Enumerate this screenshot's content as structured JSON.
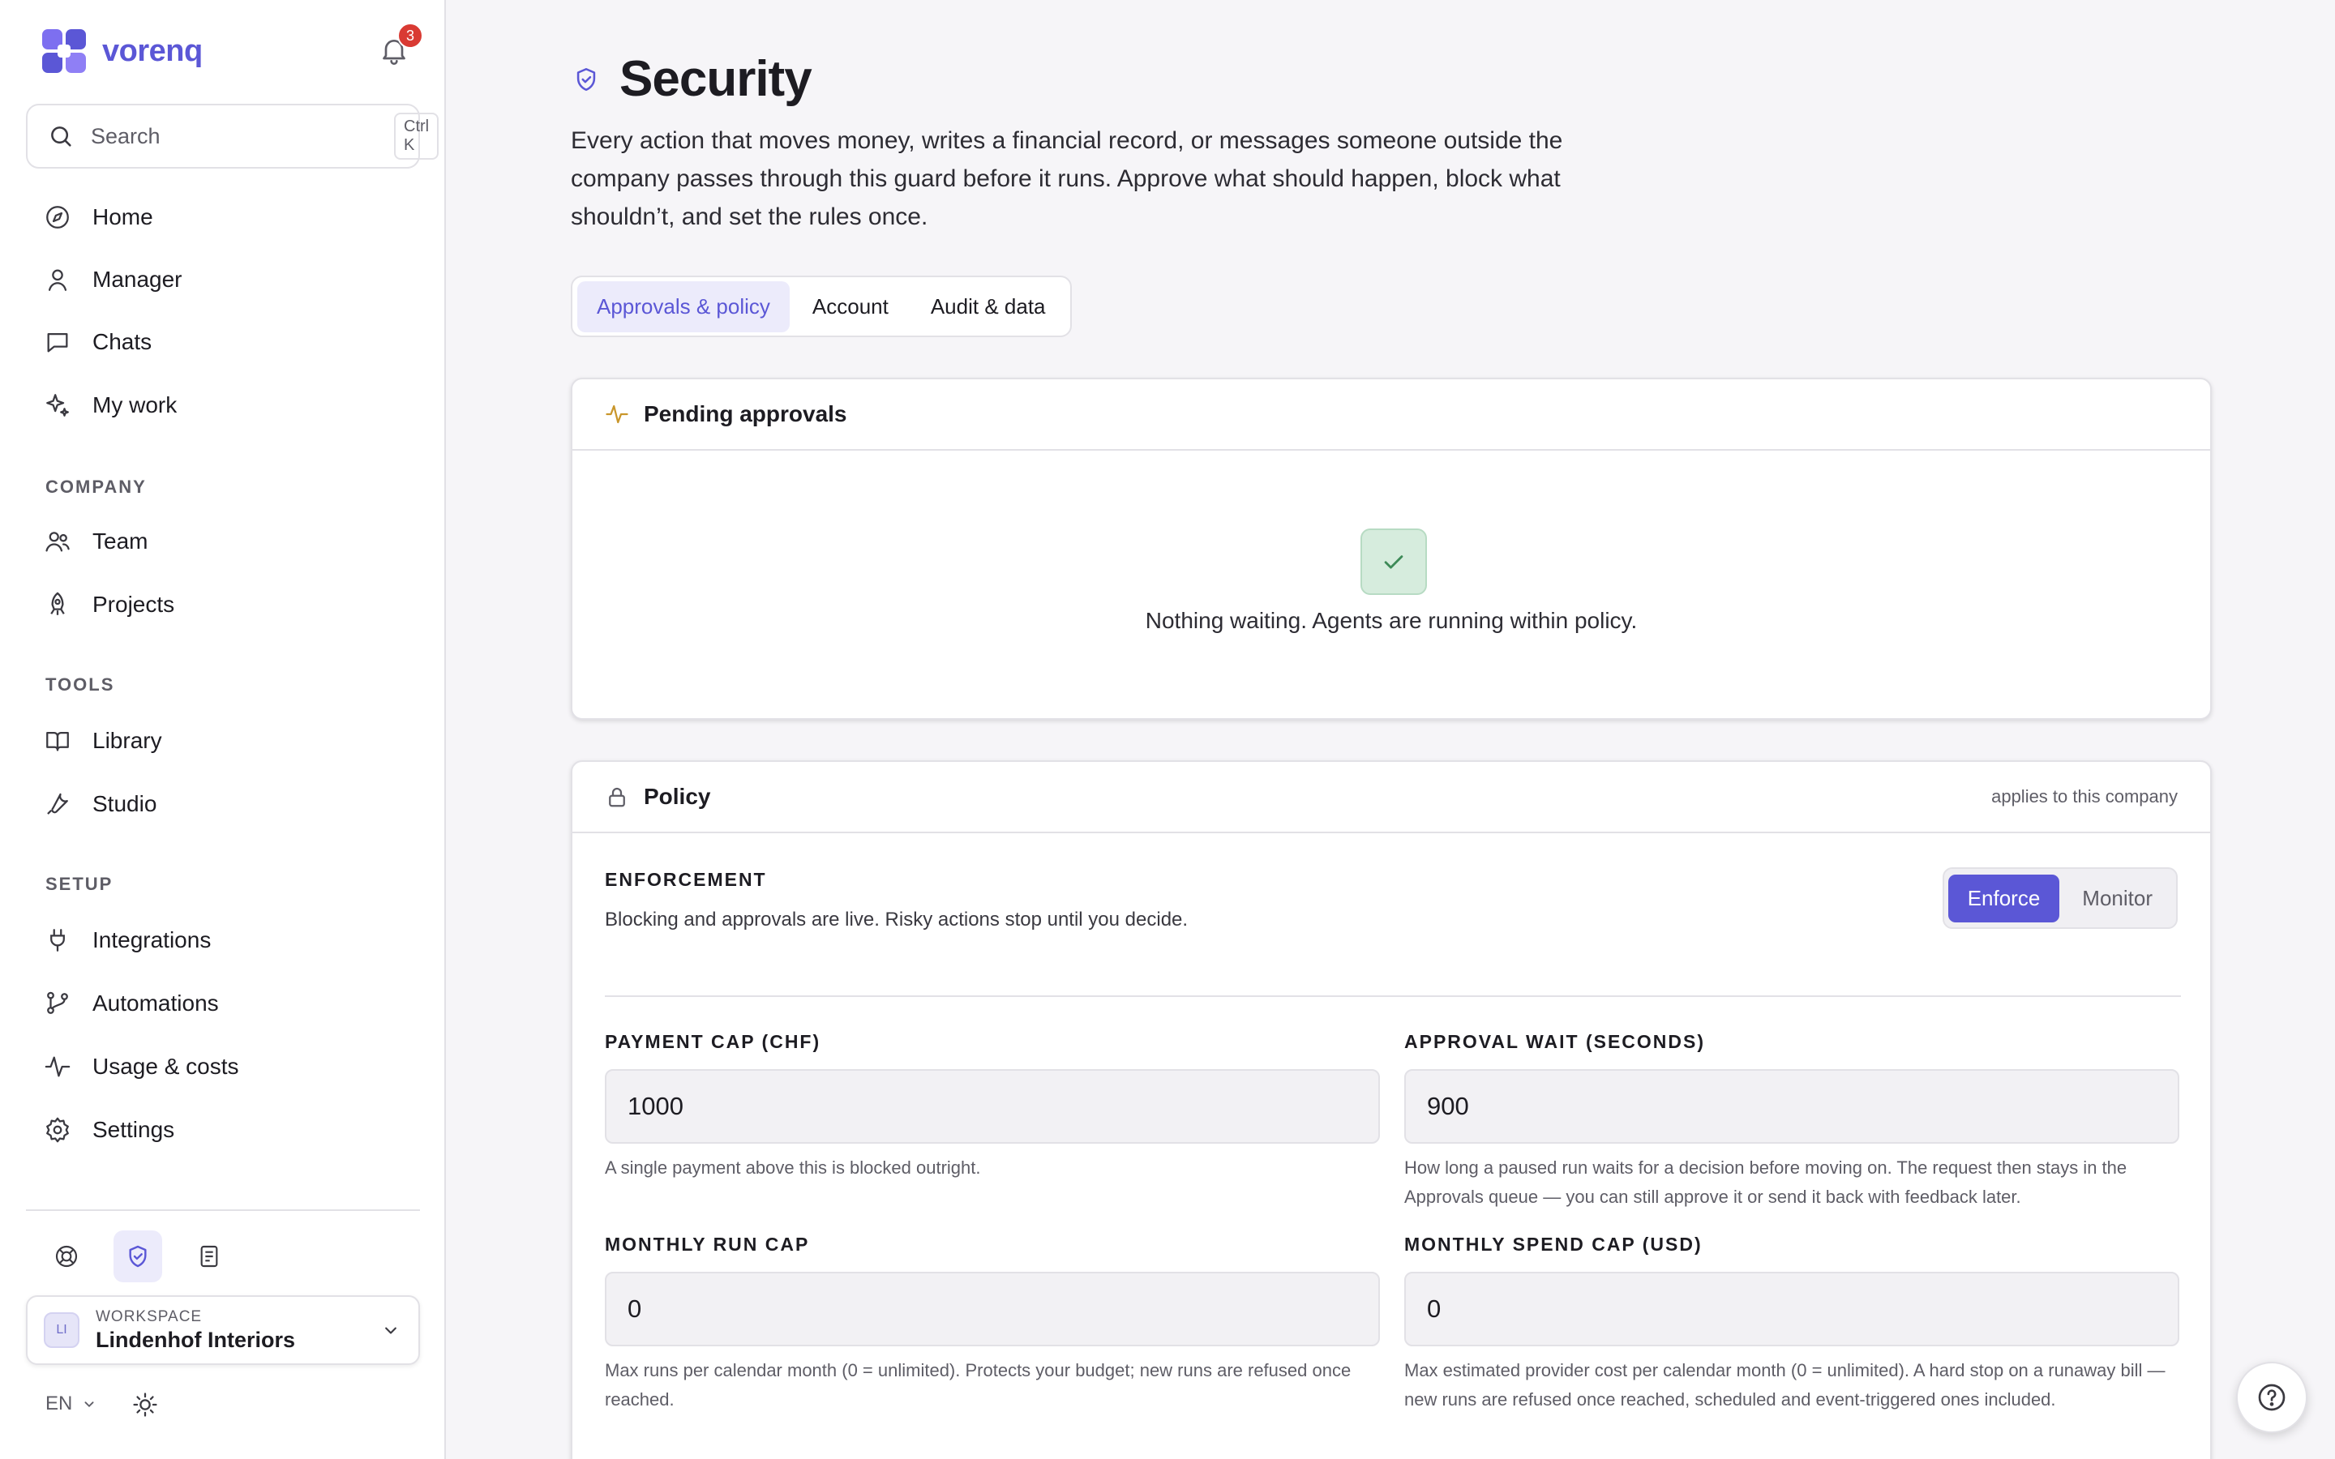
{
  "brand": {
    "name": "vorenq",
    "accent": "#5b57d6"
  },
  "notifications": {
    "count": "3"
  },
  "search": {
    "placeholder": "Search",
    "shortcut": "Ctrl K"
  },
  "nav": {
    "main": [
      {
        "label": "Home",
        "icon": "compass-icon"
      },
      {
        "label": "Manager",
        "icon": "person-icon"
      },
      {
        "label": "Chats",
        "icon": "chat-icon"
      },
      {
        "label": "My work",
        "icon": "sparkle-icon"
      }
    ],
    "company_title": "COMPANY",
    "company": [
      {
        "label": "Team",
        "icon": "users-icon"
      },
      {
        "label": "Projects",
        "icon": "rocket-icon"
      }
    ],
    "tools_title": "TOOLS",
    "tools": [
      {
        "label": "Library",
        "icon": "book-icon"
      },
      {
        "label": "Studio",
        "icon": "wrench-icon"
      }
    ],
    "setup_title": "SETUP",
    "setup": [
      {
        "label": "Integrations",
        "icon": "plug-icon"
      },
      {
        "label": "Automations",
        "icon": "branch-icon"
      },
      {
        "label": "Usage & costs",
        "icon": "activity-icon"
      },
      {
        "label": "Settings",
        "icon": "gear-icon"
      }
    ]
  },
  "workspace": {
    "label": "WORKSPACE",
    "initials": "LI",
    "name": "Lindenhof Interiors"
  },
  "language": "EN",
  "page": {
    "title": "Security",
    "description": "Every action that moves money, writes a financial record, or messages someone outside the company passes through this guard before it runs. Approve what should happen, block what shouldn’t, and set the rules once."
  },
  "tabs": [
    {
      "label": "Approvals & policy",
      "active": true
    },
    {
      "label": "Account",
      "active": false
    },
    {
      "label": "Audit & data",
      "active": false
    }
  ],
  "pending": {
    "title": "Pending approvals",
    "empty_text": "Nothing waiting. Agents are running within policy."
  },
  "policy": {
    "title": "Policy",
    "note": "applies to this company",
    "enforcement_label": "ENFORCEMENT",
    "enforcement_desc": "Blocking and approvals are live. Risky actions stop until you decide.",
    "modes": [
      "Enforce",
      "Monitor"
    ],
    "active_mode": "Enforce",
    "fields": [
      {
        "label": "PAYMENT CAP (CHF)",
        "value": "1000",
        "hint": "A single payment above this is blocked outright."
      },
      {
        "label": "APPROVAL WAIT (SECONDS)",
        "value": "900",
        "hint": "How long a paused run waits for a decision before moving on. The request then stays in the Approvals queue — you can still approve it or send it back with feedback later."
      },
      {
        "label": "MONTHLY RUN CAP",
        "value": "0",
        "hint": "Max runs per calendar month (0 = unlimited). Protects your budget; new runs are refused once reached."
      },
      {
        "label": "MONTHLY SPEND CAP (USD)",
        "value": "0",
        "hint": "Max estimated provider cost per calendar month (0 = unlimited). A hard stop on a runaway bill — new runs are refused once reached, scheduled and event-triggered ones included."
      }
    ]
  }
}
